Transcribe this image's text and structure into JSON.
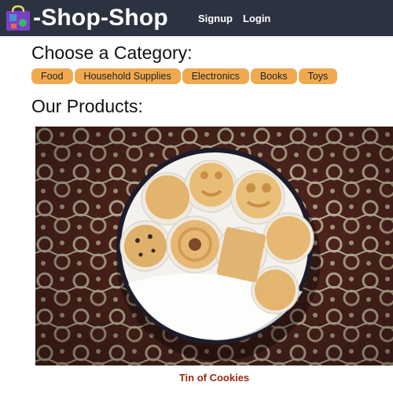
{
  "header": {
    "brand_icon": "shopping-bag-icon",
    "title": "-Shop-Shop",
    "nav": [
      {
        "label": "Signup"
      },
      {
        "label": "Login"
      }
    ]
  },
  "categories": {
    "heading": "Choose a Category:",
    "items": [
      {
        "label": "Food"
      },
      {
        "label": "Household Supplies"
      },
      {
        "label": "Electronics"
      },
      {
        "label": "Books"
      },
      {
        "label": "Toys"
      }
    ]
  },
  "products": {
    "heading": "Our Products:",
    "items": [
      {
        "name": "Tin of Cookies",
        "image": "cookie-tin-photo"
      }
    ]
  },
  "colors": {
    "header_bg": "#2b3340",
    "category_button": "#f0a94f",
    "product_name": "#9c2a12"
  }
}
